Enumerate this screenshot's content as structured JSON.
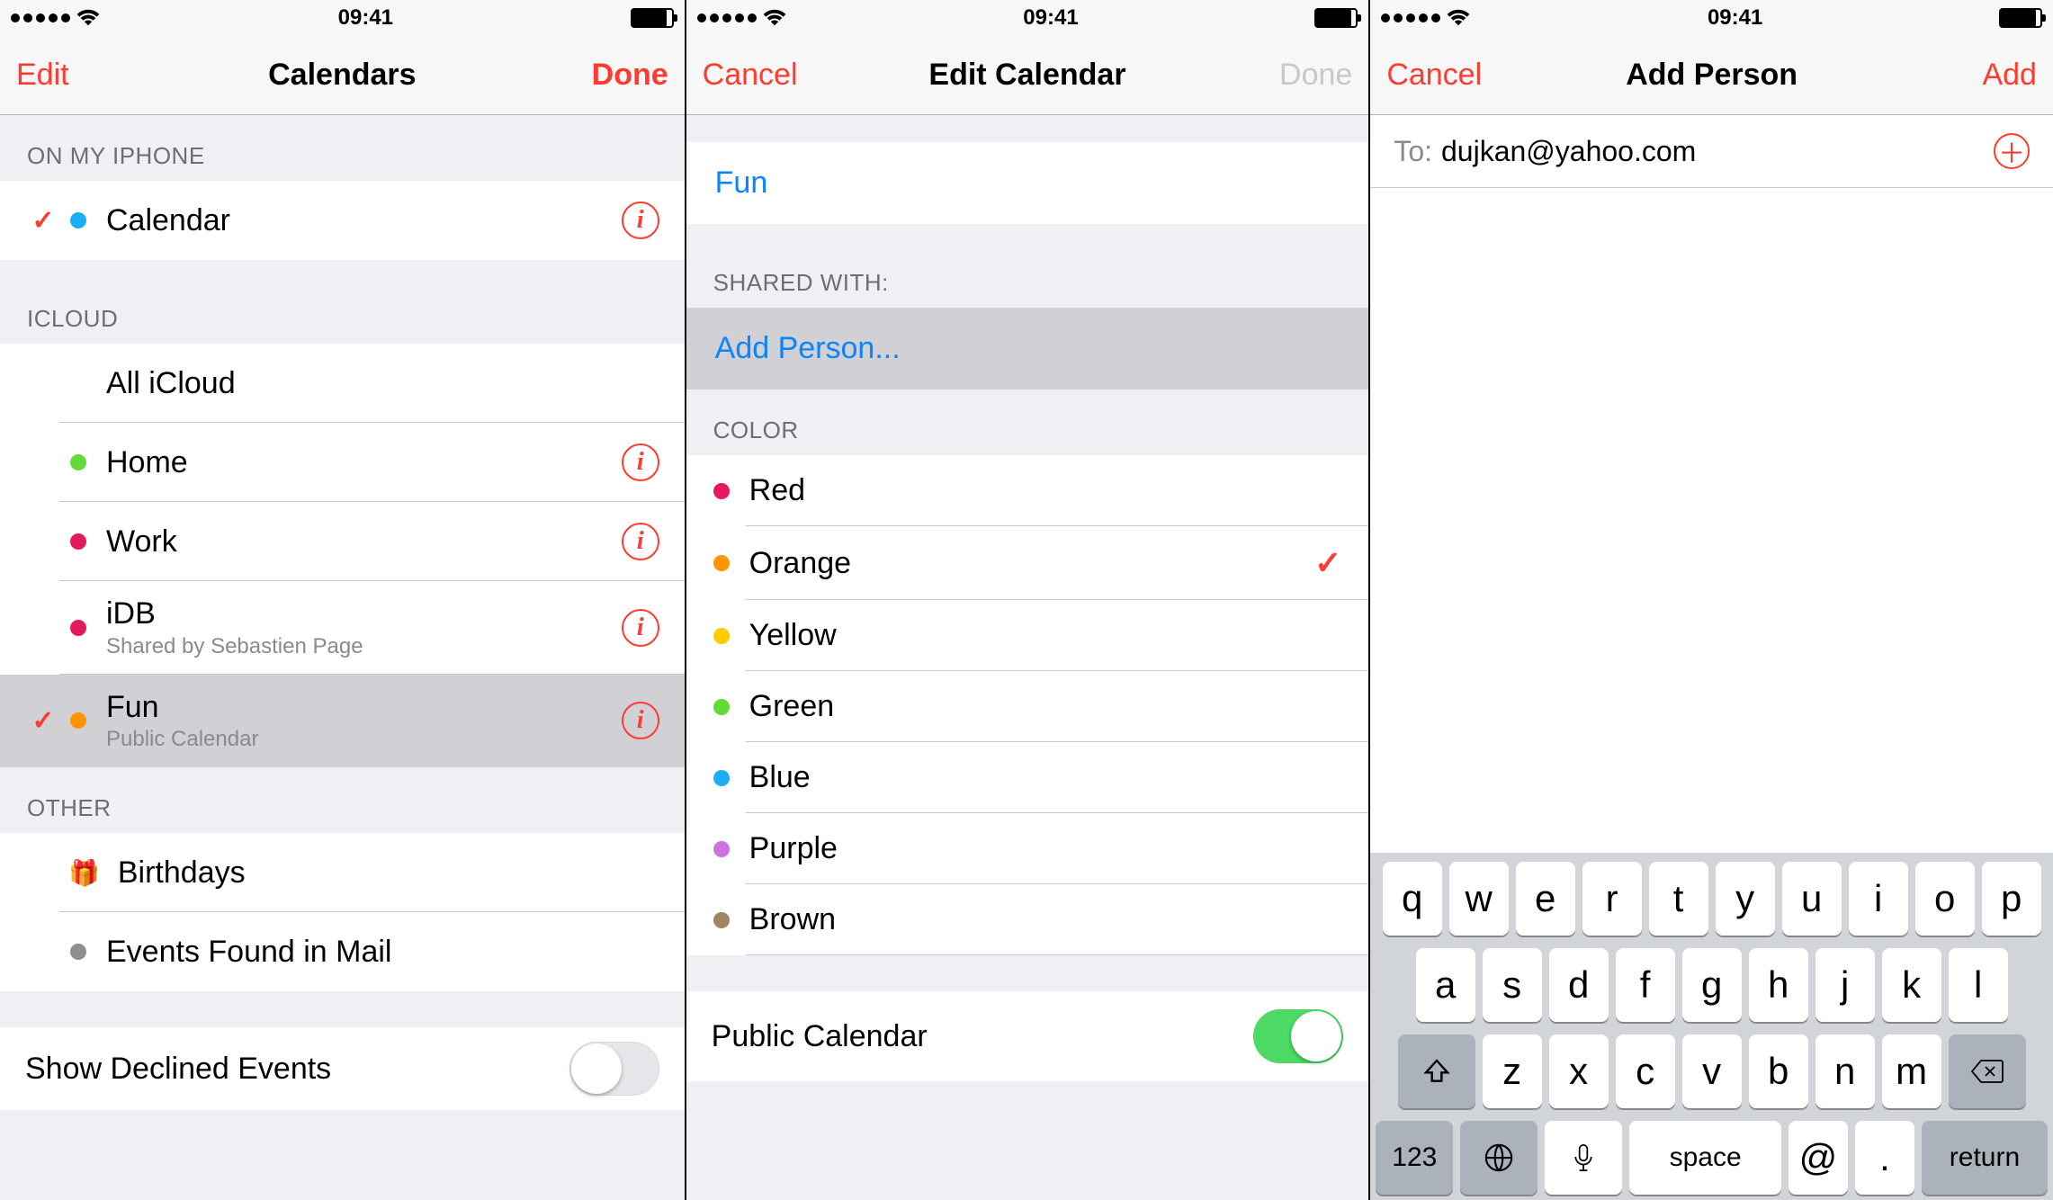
{
  "status": {
    "time": "09:41"
  },
  "screen1": {
    "nav": {
      "left": "Edit",
      "title": "Calendars",
      "right": "Done"
    },
    "sections": {
      "on_iphone_header": "ON MY IPHONE",
      "icloud_header": "ICLOUD",
      "other_header": "OTHER"
    },
    "on_iphone": [
      {
        "name": "Calendar",
        "color": "#1badf8",
        "checked": true,
        "info": true
      }
    ],
    "icloud": [
      {
        "name": "All iCloud",
        "color": null,
        "checked": false,
        "info": false
      },
      {
        "name": "Home",
        "color": "#63da38",
        "checked": false,
        "info": true
      },
      {
        "name": "Work",
        "color": "#e6185f",
        "checked": false,
        "info": true
      },
      {
        "name": "iDB",
        "sub": "Shared by Sebastien Page",
        "color": "#e6185f",
        "checked": false,
        "info": true
      },
      {
        "name": "Fun",
        "sub": "Public Calendar",
        "color": "#ff9500",
        "checked": true,
        "info": true,
        "selected": true
      }
    ],
    "other": [
      {
        "name": "Birthdays",
        "icon": "gift"
      },
      {
        "name": "Events Found in Mail",
        "color": "#8e8e93"
      }
    ],
    "declined": {
      "label": "Show Declined Events",
      "on": false
    }
  },
  "screen2": {
    "nav": {
      "left": "Cancel",
      "title": "Edit Calendar",
      "right": "Done"
    },
    "name_value": "Fun",
    "shared_header": "SHARED WITH:",
    "add_person": "Add Person...",
    "color_header": "COLOR",
    "colors": [
      {
        "name": "Red",
        "hex": "#e6185f",
        "selected": false
      },
      {
        "name": "Orange",
        "hex": "#ff9500",
        "selected": true
      },
      {
        "name": "Yellow",
        "hex": "#ffcc00",
        "selected": false
      },
      {
        "name": "Green",
        "hex": "#63da38",
        "selected": false
      },
      {
        "name": "Blue",
        "hex": "#1badf8",
        "selected": false
      },
      {
        "name": "Purple",
        "hex": "#cc73e1",
        "selected": false
      },
      {
        "name": "Brown",
        "hex": "#a2845e",
        "selected": false
      }
    ],
    "public": {
      "label": "Public Calendar",
      "on": true
    }
  },
  "screen3": {
    "nav": {
      "left": "Cancel",
      "title": "Add Person",
      "right": "Add"
    },
    "to_label": "To:",
    "to_value": "dujkan@yahoo.com",
    "keyboard": {
      "row1": [
        "q",
        "w",
        "e",
        "r",
        "t",
        "y",
        "u",
        "i",
        "o",
        "p"
      ],
      "row2": [
        "a",
        "s",
        "d",
        "f",
        "g",
        "h",
        "j",
        "k",
        "l"
      ],
      "row3": [
        "z",
        "x",
        "c",
        "v",
        "b",
        "n",
        "m"
      ],
      "fn_123": "123",
      "space": "space",
      "at": "@",
      "dot": ".",
      "return": "return"
    }
  }
}
